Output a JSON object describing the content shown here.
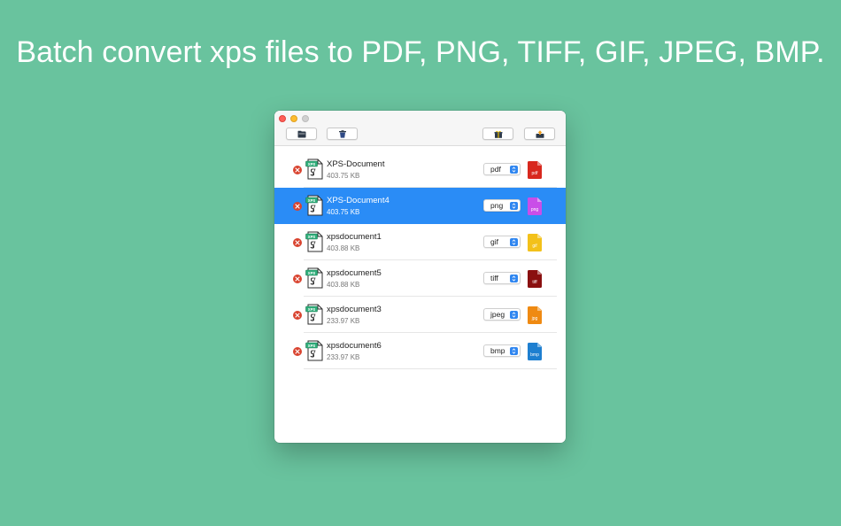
{
  "headline": "Batch convert xps files to PDF, PNG, TIFF, GIF, JPEG, BMP.",
  "toolbar": {
    "buttons": [
      {
        "name": "add-folder-button",
        "icon": "folder-icon"
      },
      {
        "name": "clear-list-button",
        "icon": "trash-icon"
      },
      {
        "name": "gift-button",
        "icon": "gift-icon"
      },
      {
        "name": "convert-export-button",
        "icon": "export-icon"
      }
    ]
  },
  "files": [
    {
      "name": "XPS-Document",
      "size": "403.75 KB",
      "format": "pdf",
      "badge_label": "pdf",
      "badge_color": "#d8281e",
      "selected": false
    },
    {
      "name": "XPS-Document4",
      "size": "403.75 KB",
      "format": "png",
      "badge_label": "png",
      "badge_color": "#c94ee8",
      "selected": true
    },
    {
      "name": "xpsdocument1",
      "size": "403.88 KB",
      "format": "gif",
      "badge_label": "gif",
      "badge_color": "#f3c11a",
      "selected": false
    },
    {
      "name": "xpsdocument5",
      "size": "403.88 KB",
      "format": "tiff",
      "badge_label": "tiff",
      "badge_color": "#8a1010",
      "selected": false
    },
    {
      "name": "xpsdocument3",
      "size": "233.97 KB",
      "format": "jpeg",
      "badge_label": "jpg",
      "badge_color": "#ef8a12",
      "selected": false
    },
    {
      "name": "xpsdocument6",
      "size": "233.97 KB",
      "format": "bmp",
      "badge_label": "bmp",
      "badge_color": "#1e7fd0",
      "selected": false
    }
  ],
  "colors": {
    "background": "#69c39e",
    "selection": "#2a8cf6",
    "remove": "#d9432f"
  }
}
